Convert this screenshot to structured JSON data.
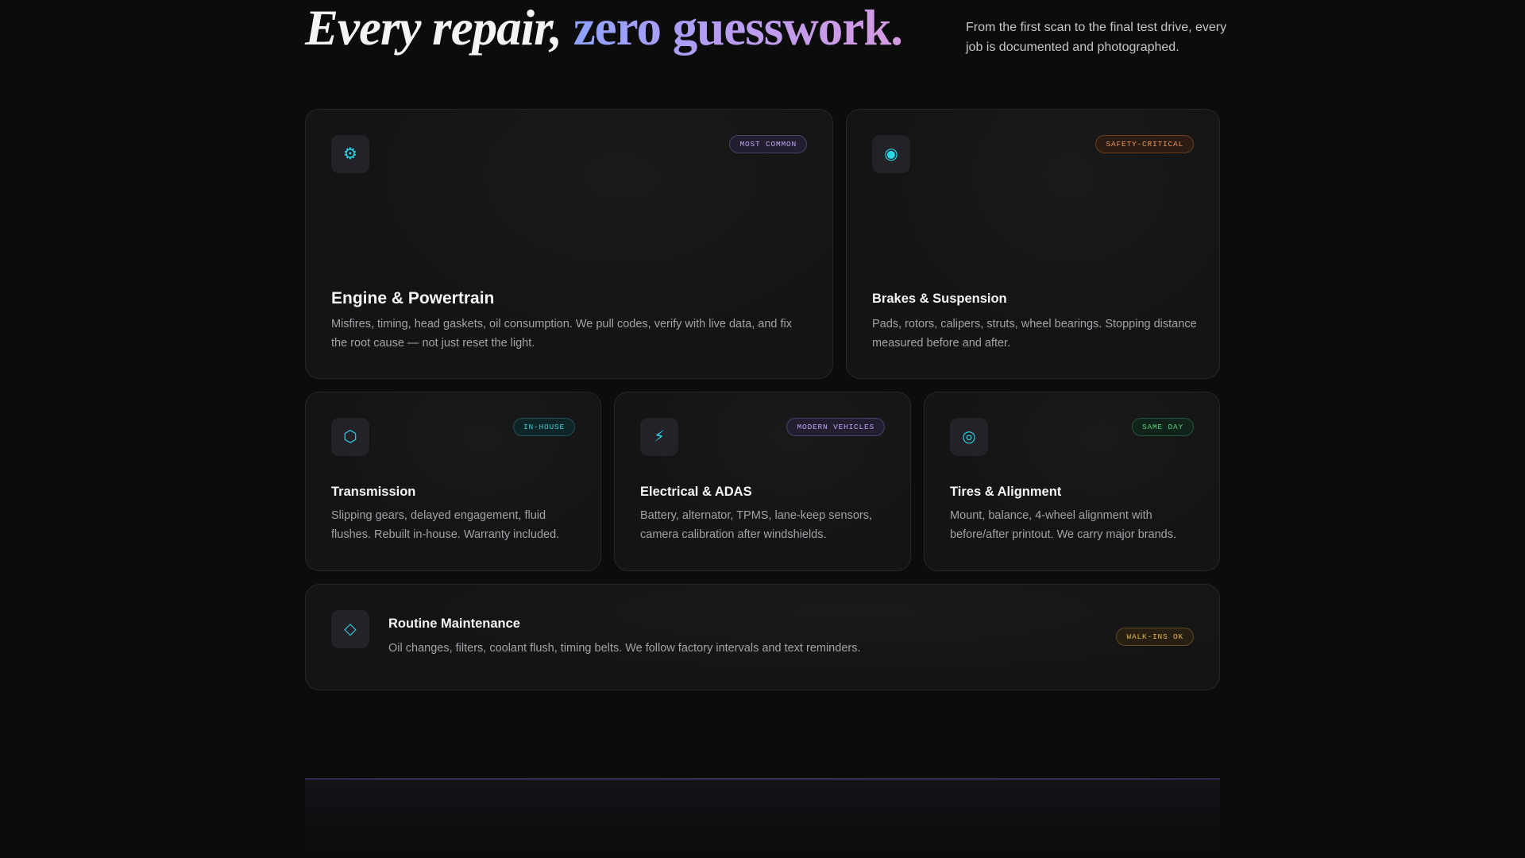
{
  "hero": {
    "title_plain": "Every repair, ",
    "title_accent": "zero guesswork.",
    "subtitle": "From the first scan to the final test drive, every job is documented and photographed."
  },
  "services": [
    {
      "icon": "gear-icon",
      "glyph": "⚙",
      "badge": "MOST COMMON",
      "badge_color": "#b9a6f0",
      "title": "Engine & Powertrain",
      "desc": "Misfires, timing, head gaskets, oil consumption. We pull codes, verify with live data, and fix the root cause — not just reset the light."
    },
    {
      "icon": "brake-disc-icon",
      "glyph": "◉",
      "badge": "SAFETY-CRITICAL",
      "badge_color": "#e8955a",
      "title": "Brakes & Suspension",
      "desc": "Pads, rotors, calipers, struts, wheel bearings. Stopping distance measured before and after."
    },
    {
      "icon": "hexagon-icon",
      "glyph": "⬡",
      "badge": "IN-HOUSE",
      "badge_color": "#37d1d6",
      "title": "Transmission",
      "desc": "Slipping gears, delayed engagement, fluid flushes. Rebuilt in-house. Warranty included."
    },
    {
      "icon": "lightning-bolt-icon",
      "glyph": "⚡",
      "badge": "MODERN VEHICLES",
      "badge_color": "#b9a6f0",
      "title": "Electrical & ADAS",
      "desc": "Battery, alternator, TPMS, lane-keep sensors, camera calibration after windshields."
    },
    {
      "icon": "target-icon",
      "glyph": "◎",
      "badge": "SAME DAY",
      "badge_color": "#53cf7c",
      "title": "Tires & Alignment",
      "desc": "Mount, balance, 4-wheel alignment with before/after printout. We carry major brands."
    },
    {
      "icon": "diamond-icon",
      "glyph": "◇",
      "badge": "WALK-INS OK",
      "badge_color": "#e7b34a",
      "title": "Routine Maintenance",
      "desc": "Oil changes, filters, coolant flush, timing belts. We follow factory intervals and text reminders."
    }
  ],
  "colors": {
    "background": "#0c0c0d",
    "card": "#141415",
    "icon_accent": "#2fd4e6",
    "gradient_start": "#8ea2ff",
    "gradient_end": "#d69be0"
  }
}
